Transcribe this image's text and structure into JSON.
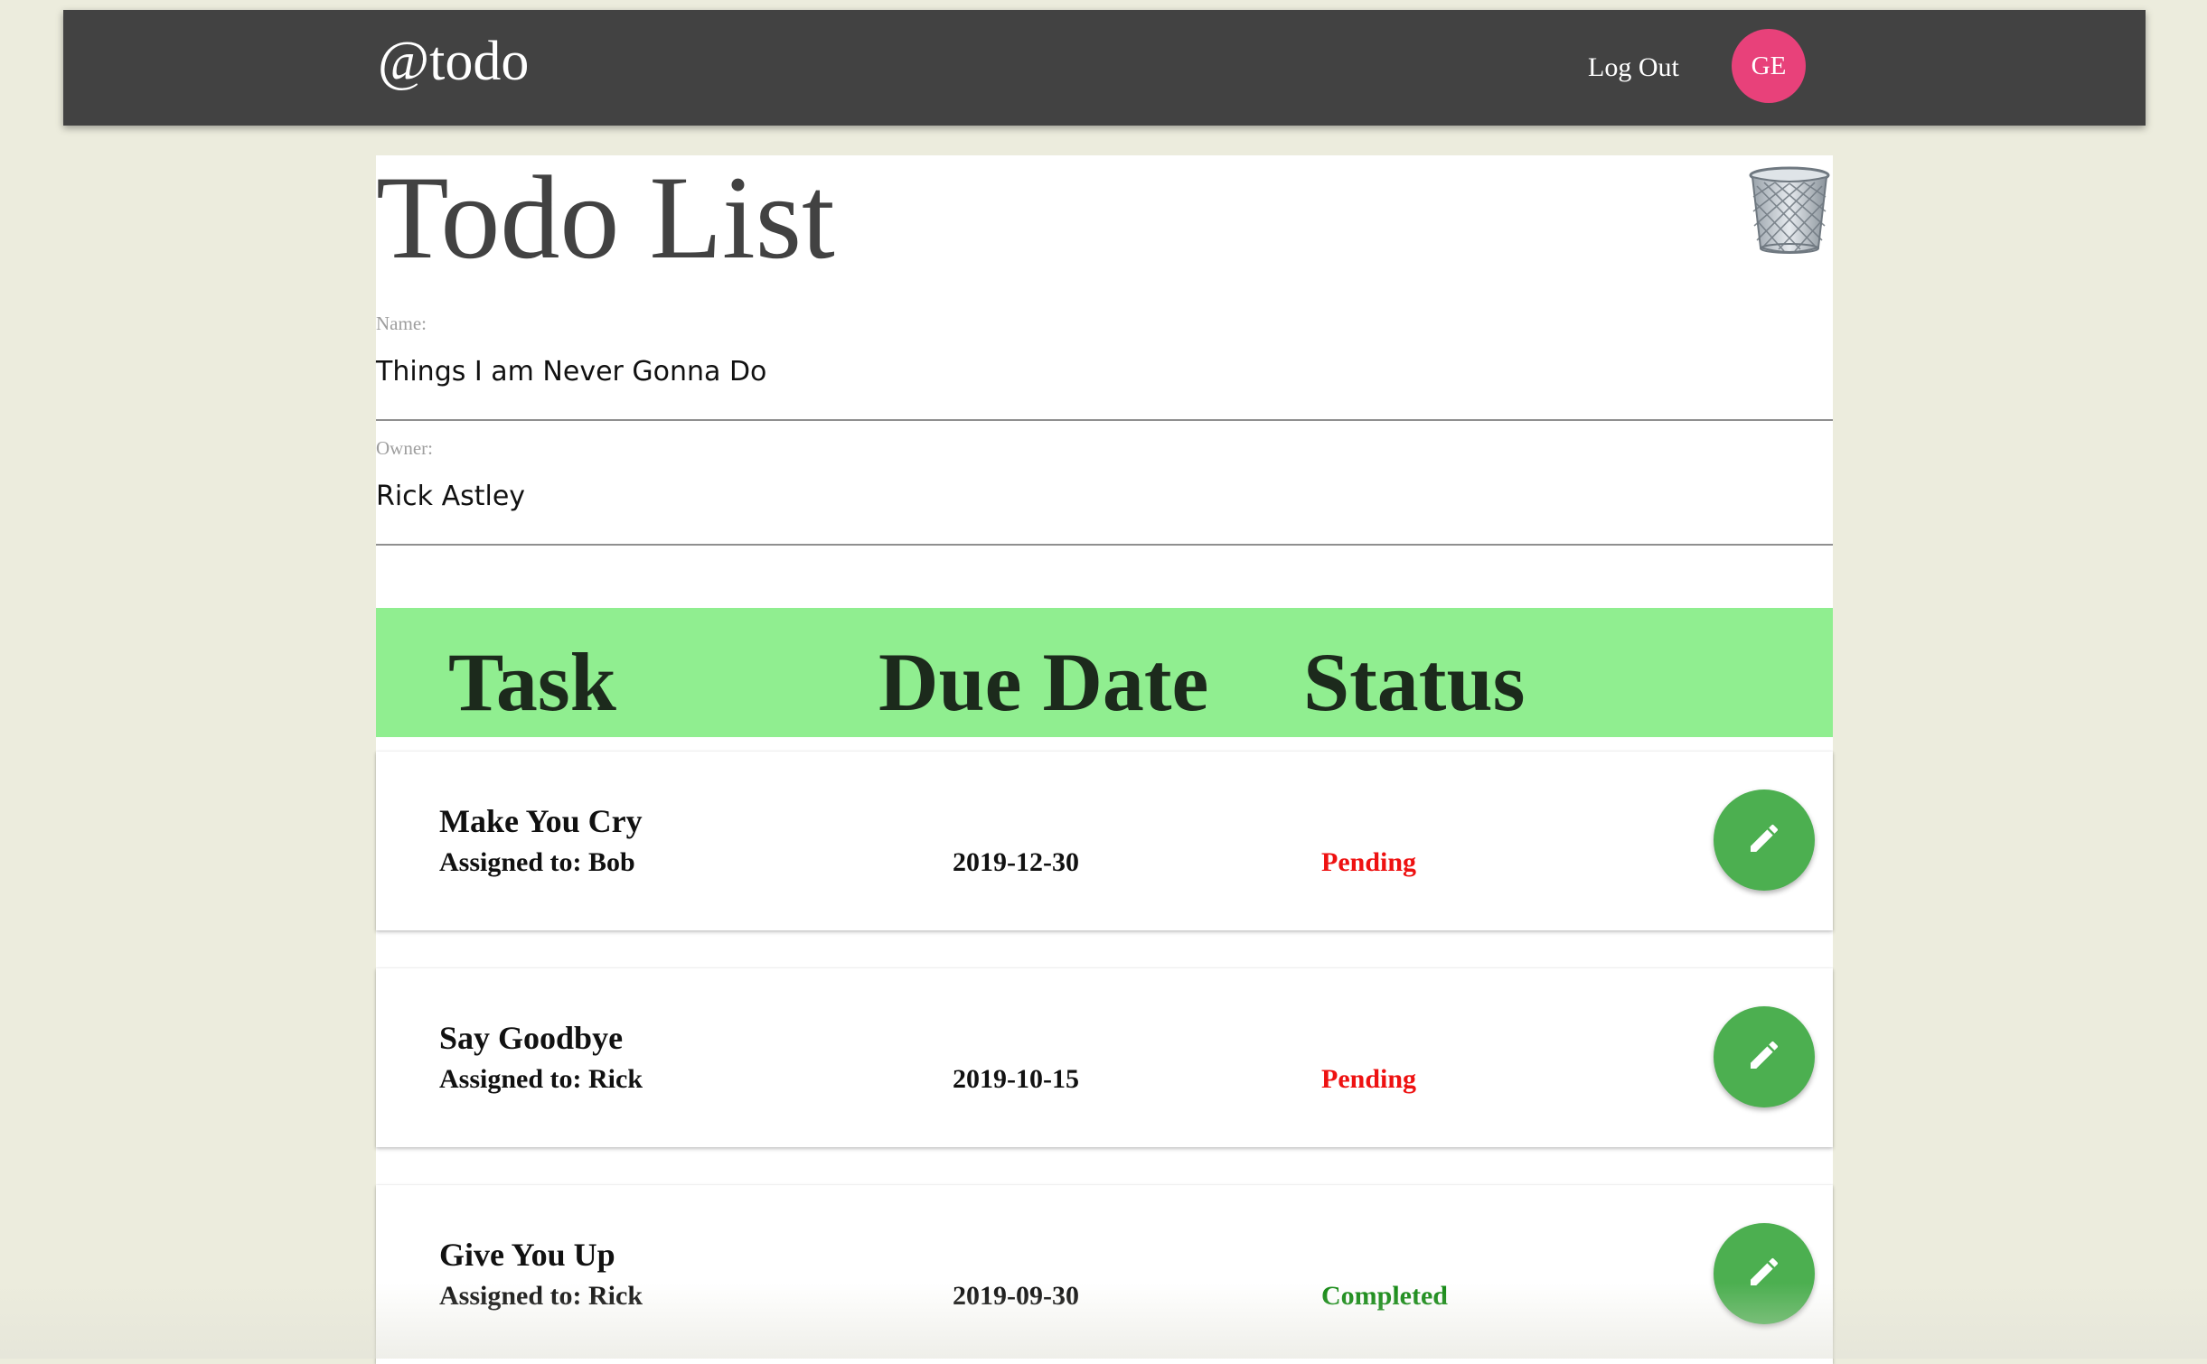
{
  "navbar": {
    "brand": "@todo",
    "logout_label": "Log Out",
    "avatar_initials": "GE",
    "background_color": "#424242",
    "avatar_color": "#e8417a"
  },
  "list": {
    "title": "Todo List",
    "name_label": "Name:",
    "name_value": "Things I am Never Gonna Do",
    "owner_label": "Owner:",
    "owner_value": "Rick Astley",
    "delete_icon": "trash-can-icon"
  },
  "table": {
    "header_color": "#90ee90",
    "headers": {
      "task": "Task",
      "due_date": "Due Date",
      "status": "Status"
    },
    "rows": [
      {
        "task": "Make You Cry",
        "assigned": "Assigned to: Bob",
        "due_date": "2019-12-30",
        "status": "Pending"
      },
      {
        "task": "Say Goodbye",
        "assigned": "Assigned to: Rick",
        "due_date": "2019-10-15",
        "status": "Pending"
      },
      {
        "task": "Give You Up",
        "assigned": "Assigned to: Rick",
        "due_date": "2019-09-30",
        "status": "Completed"
      }
    ],
    "edit_icon": "pencil-icon",
    "edit_button_color": "#4caf50",
    "pending_color": "#ee1111",
    "completed_color": "#118811"
  }
}
